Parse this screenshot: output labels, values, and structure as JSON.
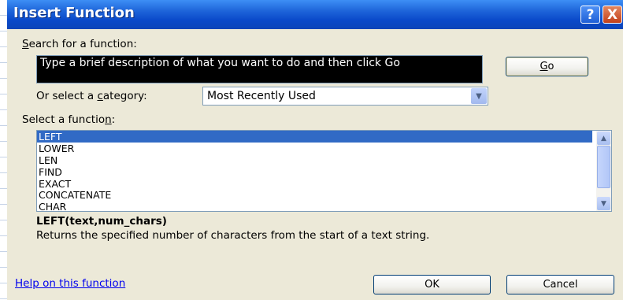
{
  "dialog": {
    "title": "Insert Function",
    "help_button": "?",
    "close_button": "X"
  },
  "search": {
    "label_prefix": "",
    "label_accel": "S",
    "label_rest": "earch for a function:",
    "value": "Type a brief description of what you want to do and then click Go",
    "go_prefix": "",
    "go_accel": "G",
    "go_rest": "o"
  },
  "category": {
    "label_prefix": "Or select a ",
    "label_accel": "c",
    "label_rest": "ategory:",
    "selected": "Most Recently Used"
  },
  "functions": {
    "label_prefix": "Select a functio",
    "label_accel": "n",
    "label_rest": ":",
    "items": [
      "LEFT",
      "LOWER",
      "LEN",
      "FIND",
      "EXACT",
      "CONCATENATE",
      "CHAR"
    ],
    "selected_index": 0
  },
  "detail": {
    "syntax": "LEFT(text,num_chars)",
    "description": "Returns the specified number of characters from the start of a text string."
  },
  "footer": {
    "help_link": "Help on this function",
    "ok": "OK",
    "cancel": "Cancel"
  }
}
